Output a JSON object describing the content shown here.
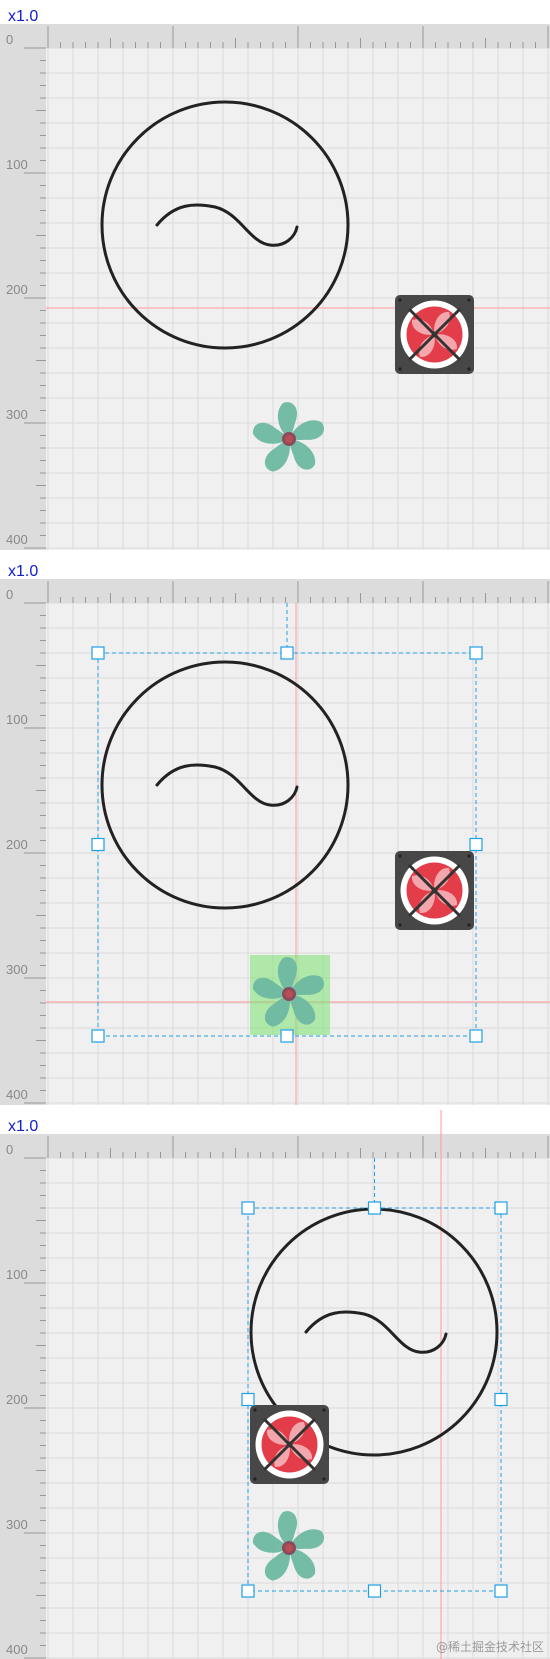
{
  "canvas": {
    "zoom_label": "x1.0",
    "ruler_labels": [
      "0",
      "100",
      "200",
      "300",
      "400"
    ],
    "colors": {
      "background": "#f0f0f0",
      "ruler": "#dcdcdc",
      "grid": "#dadada",
      "guide": "#ff9a9a",
      "selection": "#1ea0e6",
      "fan_red": "#e43d4a",
      "fan_housing": "#474747",
      "propeller": "#6eb8a2",
      "highlight": "#7ae26f"
    }
  },
  "panels": [
    {
      "name": "state-initial",
      "selected": false
    },
    {
      "name": "state-propeller-selected",
      "selected": true
    },
    {
      "name": "state-group-moved",
      "selected": true
    }
  ],
  "icons": {
    "ac_source": "ac-power-source-icon",
    "exhaust_fan": "exhaust-fan-icon",
    "propeller": "propeller-fan-icon"
  },
  "watermark": "@稀土掘金技术社区"
}
